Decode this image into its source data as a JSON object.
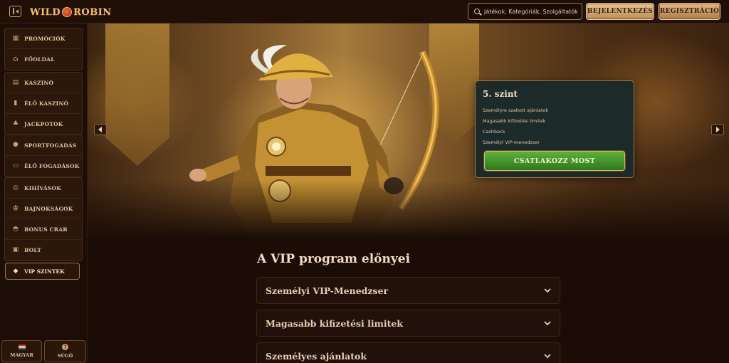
{
  "header": {
    "logo_text_1": "WILD",
    "logo_text_2": "ROBIN",
    "search_placeholder": "Játékok, Kategóriák, Szolgáltatók",
    "login_label": "BEJELENTKEZÉS",
    "register_label": "REGISZTRÁCIÓ"
  },
  "sidebar": {
    "group1": [
      {
        "label": "PROMÓCIÓK",
        "icon": "gift-icon"
      },
      {
        "label": "FŐOLDAL",
        "icon": "home-icon"
      }
    ],
    "group2": [
      {
        "label": "KASZINÓ",
        "icon": "slot-icon"
      },
      {
        "label": "ÉLŐ KASZINÓ",
        "icon": "cards-icon"
      },
      {
        "label": "JACKPOTOK",
        "icon": "clover-icon"
      }
    ],
    "group3": [
      {
        "label": "SPORTFOGADÁS",
        "icon": "ball-icon"
      },
      {
        "label": "ÉLŐ FOGADÁSOK",
        "icon": "live-icon"
      }
    ],
    "group4": [
      {
        "label": "KIHÍVÁSOK",
        "icon": "target-icon"
      },
      {
        "label": "BAJNOKSÁGOK",
        "icon": "trophy-icon"
      },
      {
        "label": "BONUS CRAB",
        "icon": "crab-icon"
      },
      {
        "label": "BOLT",
        "icon": "bag-icon"
      }
    ],
    "vip_label": "VIP SZINTEK",
    "language_label": "MAGYAR",
    "help_label": "SÚGÓ"
  },
  "hero": {
    "level_title": "5. szint",
    "benefits": [
      "Személyre szabott ajánlatok",
      "Magasabb kifizetési limitek",
      "Cashback",
      "Személyi VIP-menedzser"
    ],
    "join_label": "CSATLAKOZZ MOST"
  },
  "vip_section": {
    "heading": "A VIP program előnyei",
    "items": [
      "Személyi VIP-Menedzser",
      "Magasabb kifizetési limitek",
      "Személyes ajánlatok"
    ]
  },
  "colors": {
    "background": "#1b0d06",
    "accent_gold": "#c9a46a",
    "join_green": "#3d9226"
  }
}
